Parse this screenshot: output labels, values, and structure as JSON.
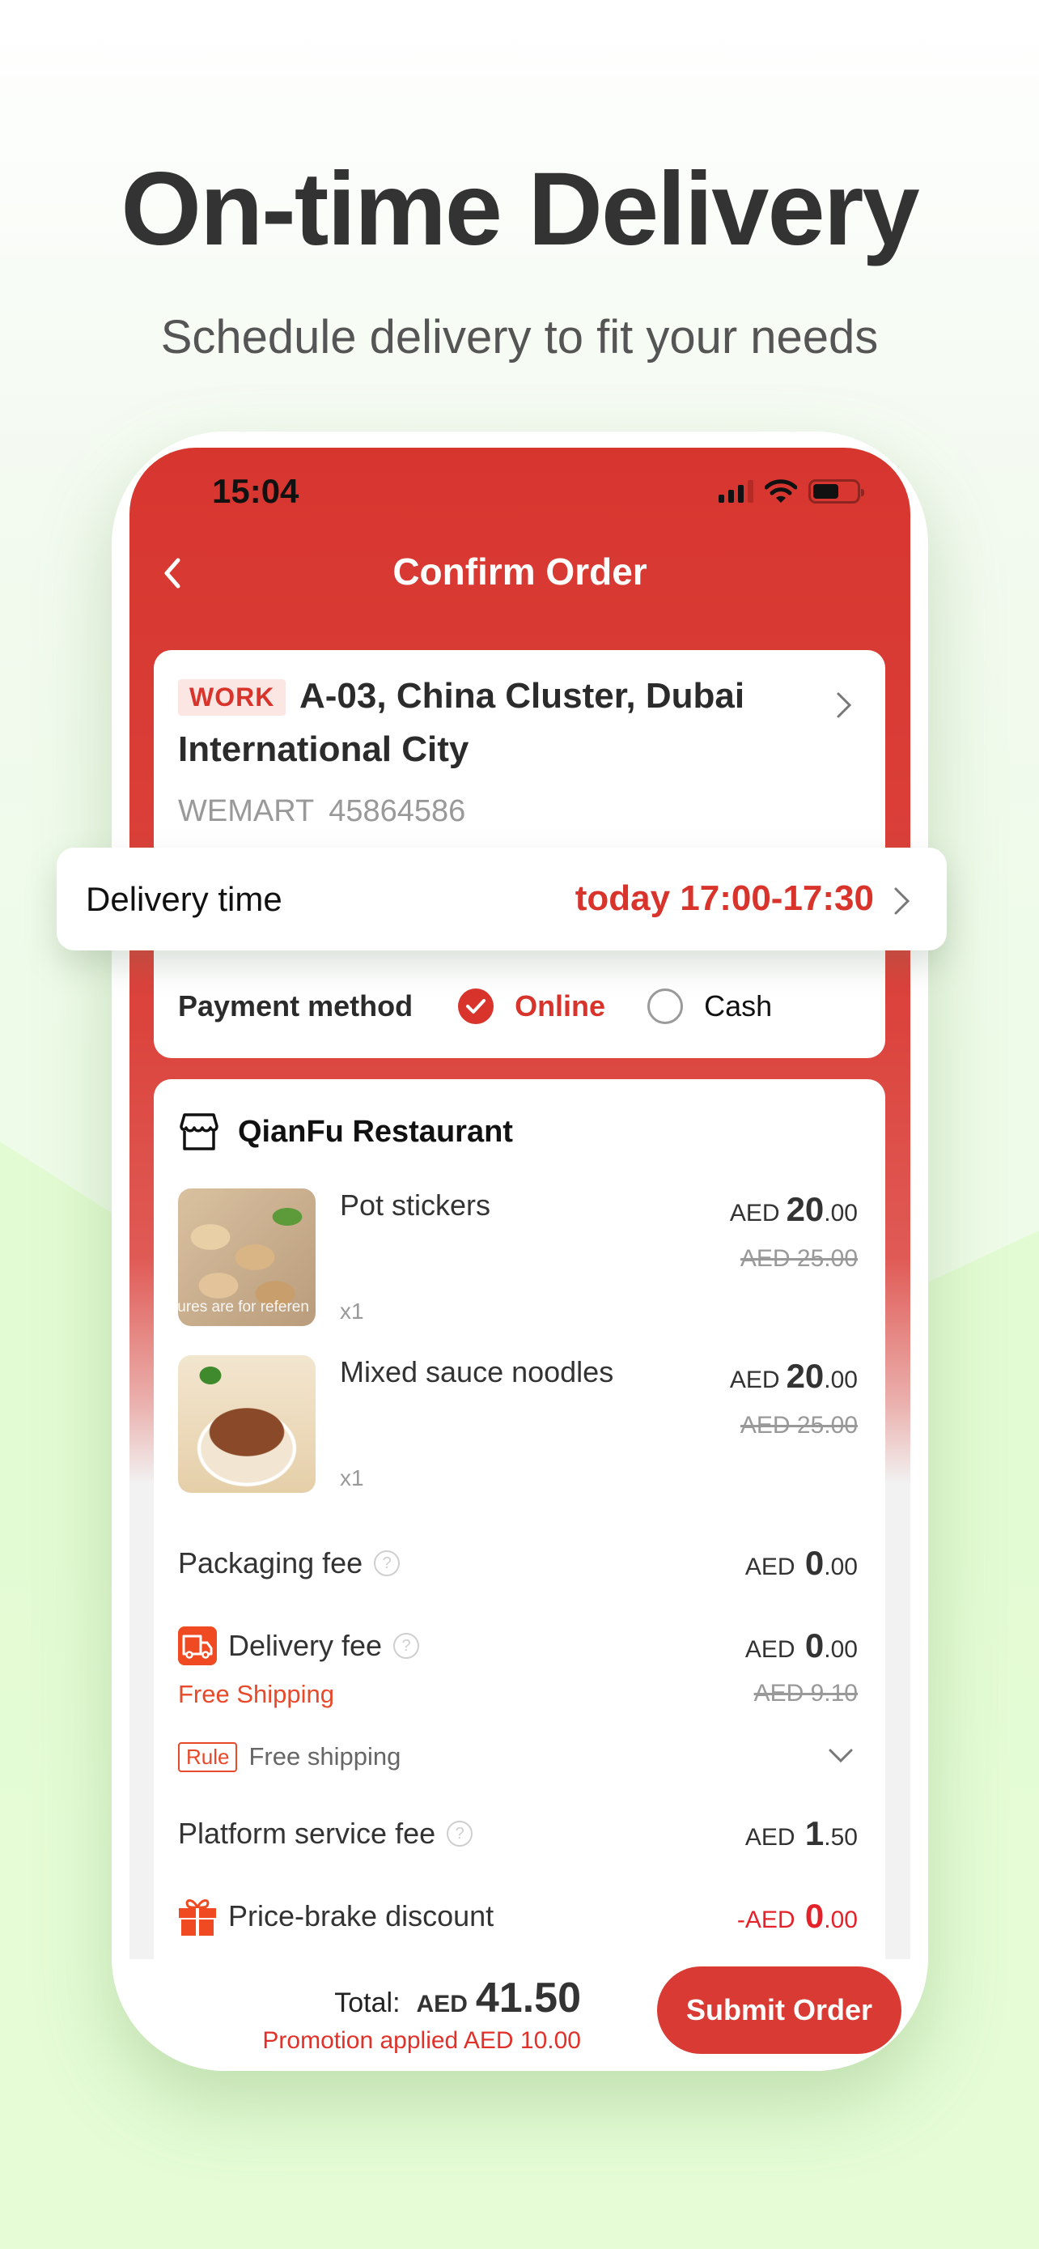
{
  "hero": {
    "title": "On-time Delivery",
    "subtitle": "Schedule delivery to fit your needs"
  },
  "status_bar": {
    "time": "15:04",
    "icons": [
      "cellular-signal-icon",
      "wifi-icon",
      "battery-icon"
    ]
  },
  "nav": {
    "back_icon": "chevron-left-icon",
    "title": "Confirm Order"
  },
  "address": {
    "tag": "WORK",
    "line1": "A-03, China Cluster, Dubai",
    "line2": "International City",
    "name": "WEMART",
    "phone": "45864586"
  },
  "delivery_time": {
    "label": "Delivery time",
    "value": "today 17:00-17:30"
  },
  "payment": {
    "label": "Payment method",
    "options": [
      {
        "label": "Online",
        "selected": true
      },
      {
        "label": "Cash",
        "selected": false
      }
    ]
  },
  "restaurant": {
    "icon": "store-icon",
    "name": "QianFu Restaurant",
    "items": [
      {
        "name": "Pot stickers",
        "qty": "x1",
        "currency": "AED",
        "price_int": "20",
        "price_dec": ".00",
        "original_price": "AED 25.00",
        "image_caption": "tures are for referen"
      },
      {
        "name": "Mixed sauce noodles",
        "qty": "x1",
        "currency": "AED",
        "price_int": "20",
        "price_dec": ".00",
        "original_price": "AED 25.00"
      }
    ]
  },
  "fees": {
    "packaging": {
      "label": "Packaging fee",
      "currency": "AED",
      "int": "0",
      "dec": ".00"
    },
    "delivery": {
      "label": "Delivery fee",
      "currency": "AED",
      "int": "0",
      "dec": ".00",
      "promo": "Free Shipping",
      "original": "AED 9.10"
    },
    "rule": {
      "tag": "Rule",
      "text": "Free shipping"
    },
    "platform": {
      "label": "Platform service fee",
      "currency": "AED",
      "int": "1",
      "dec": ".50"
    },
    "discount": {
      "label": "Price-brake discount",
      "currency": "-AED",
      "int": "0",
      "dec": ".00"
    }
  },
  "footer": {
    "total_label": "Total:",
    "total_currency": "AED",
    "total_value": "41.50",
    "promotion": "Promotion applied AED 10.00",
    "submit_label": "Submit Order"
  },
  "colors": {
    "brand_red": "#d8342c",
    "promo_orange": "#e8492a",
    "background_green": "#e3fbd3"
  }
}
